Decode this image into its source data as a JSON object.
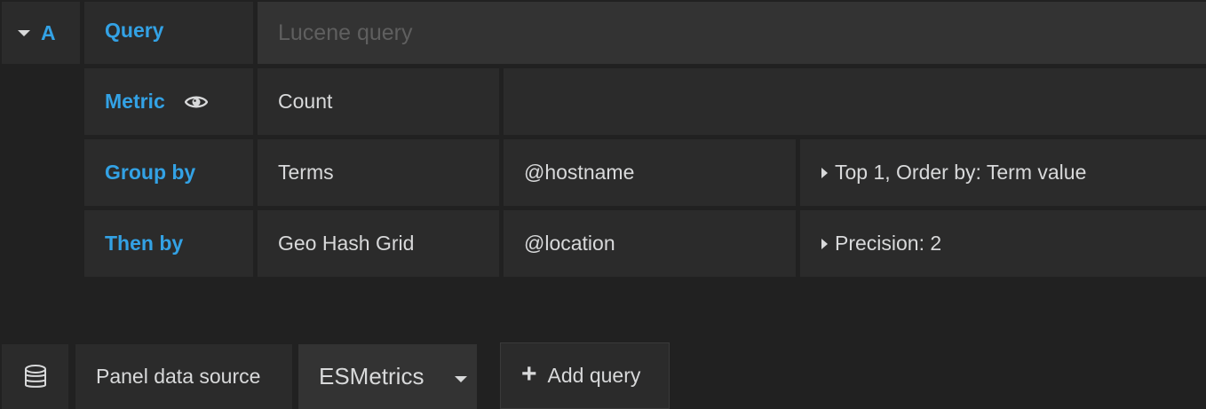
{
  "query_row": {
    "ref_id": "A",
    "label": "Query",
    "placeholder": "Lucene query"
  },
  "metric_row": {
    "label": "Metric",
    "type": "Count"
  },
  "group_by_row": {
    "label": "Group by",
    "aggregation": "Terms",
    "field": "@hostname",
    "settings": "Top 1, Order by: Term value"
  },
  "then_by_row": {
    "label": "Then by",
    "aggregation": "Geo Hash Grid",
    "field": "@location",
    "settings": "Precision: 2"
  },
  "footer": {
    "panel_data_source_label": "Panel data source",
    "datasource_selected": "ESMetrics",
    "add_query_label": "Add query"
  },
  "colors": {
    "accent": "#33a2e5",
    "background": "#212121",
    "cell": "#2b2b2b",
    "text": "#d8d9da"
  },
  "icons": {
    "collapse": "caret-down-icon",
    "visibility": "eye-icon",
    "database": "database-icon",
    "expand": "caret-right-icon",
    "add": "plus-icon"
  }
}
